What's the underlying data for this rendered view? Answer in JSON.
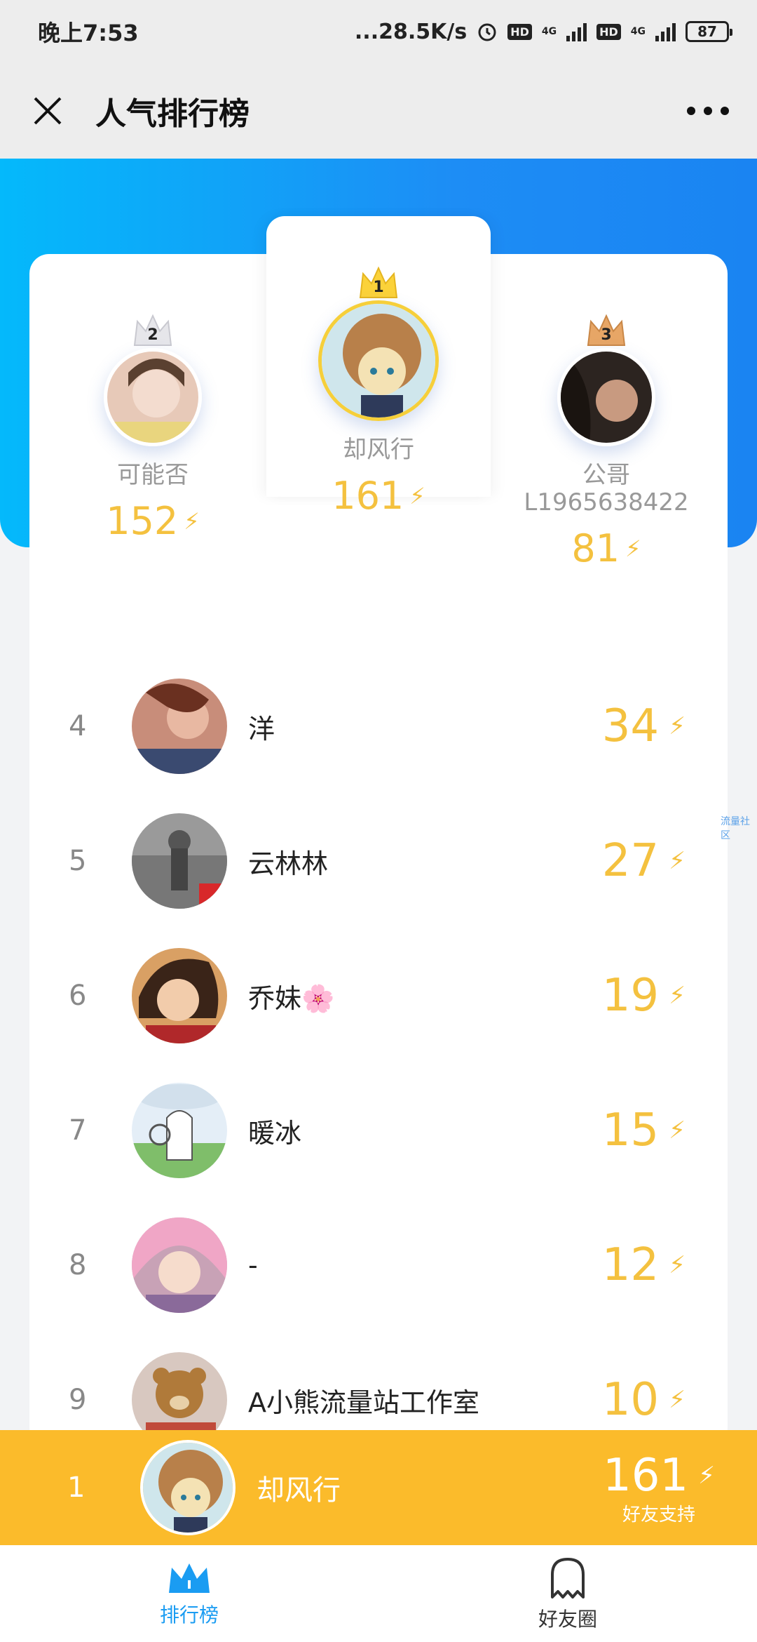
{
  "status_bar": {
    "time": "晚上7:53",
    "network_speed": "...28.5K/s",
    "hd1": "HD",
    "net1": "4G",
    "hd2": "HD",
    "net2": "4G",
    "battery": "87"
  },
  "header": {
    "title": "人气排行榜",
    "close_icon": "close-icon",
    "more_icon": "more-icon"
  },
  "podium": {
    "first": {
      "rank": "1",
      "name": "却风行",
      "score": "161"
    },
    "second": {
      "rank": "2",
      "name": "可能否",
      "score": "152"
    },
    "third": {
      "rank": "3",
      "name_line1": "公哥",
      "name_line2": "L1965638422",
      "score": "81"
    }
  },
  "rank_list": [
    {
      "rank": "4",
      "name": "洋",
      "score": "34"
    },
    {
      "rank": "5",
      "name": "云林林",
      "score": "27"
    },
    {
      "rank": "6",
      "name": "乔妹🌸",
      "score": "19"
    },
    {
      "rank": "7",
      "name": "暖冰",
      "score": "15"
    },
    {
      "rank": "8",
      "name": "-",
      "score": "12"
    },
    {
      "rank": "9",
      "name": "A小熊流量站工作室",
      "score": "10"
    }
  ],
  "side_label": "流量社区",
  "my_rank": {
    "rank": "1",
    "name": "却风行",
    "score": "161",
    "subtitle": "好友支持"
  },
  "bottom_nav": {
    "tab_ranking": "排行榜",
    "tab_friends": "好友圈"
  },
  "colors": {
    "banner_start": "#04b9fb",
    "banner_end": "#1a84f2",
    "score_gold": "#f4c13f",
    "my_bar": "#fbbb2b",
    "nav_active": "#1a9cf2"
  }
}
